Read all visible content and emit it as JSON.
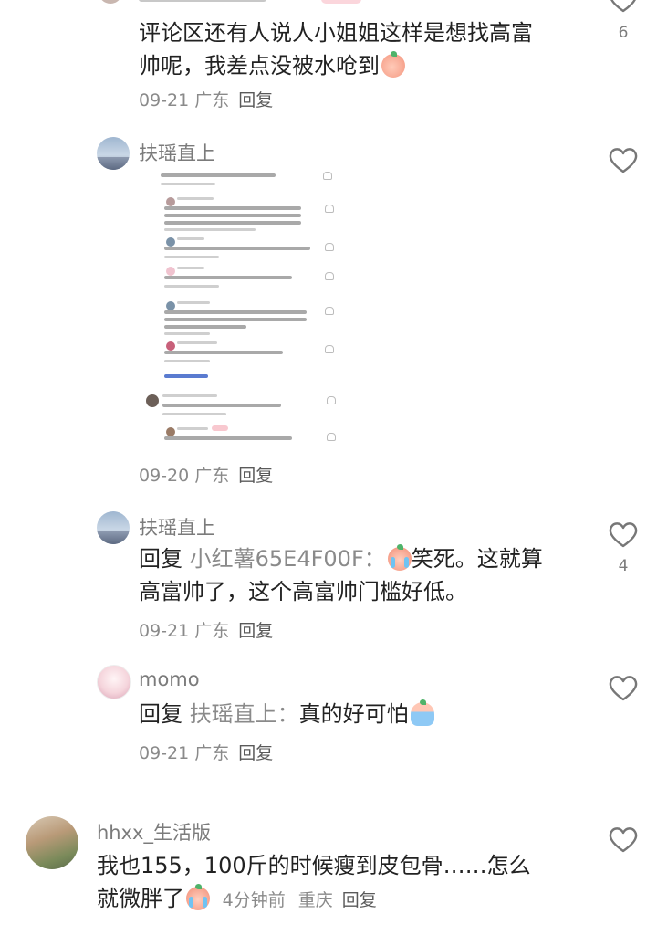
{
  "comments": [
    {
      "text_lines": [
        "评论区还有人说人小姐姐这样是想找高富",
        "帅呢，我差点没被水呛到"
      ],
      "emoji": "peach-emoji",
      "meta": {
        "date": "09-21",
        "location": "广东",
        "reply": "回复"
      },
      "like_count": "6"
    },
    {
      "name": "扶瑶直上",
      "meta": {
        "date": "09-20",
        "location": "广东",
        "reply": "回复"
      }
    },
    {
      "name": "扶瑶直上",
      "reply_prefix": "回复",
      "reply_target": "小红薯65E4F00F：",
      "text_tail": "笑死。这就算",
      "text_line2": "高富帅了，这个高富帅门槛好低。",
      "emoji": "crying-emoji",
      "meta": {
        "date": "09-21",
        "location": "广东",
        "reply": "回复"
      },
      "like_count": "4"
    },
    {
      "name": "momo",
      "reply_prefix": "回复",
      "reply_target": "扶瑶直上：",
      "text_tail": "真的好可怕",
      "emoji": "fearful-emoji",
      "meta": {
        "date": "09-21",
        "location": "广东",
        "reply": "回复"
      }
    },
    {
      "name": "hhxx_生活版",
      "text_line1": "我也155，100斤的时候瘦到皮包骨……怎么",
      "text_line2": "就微胖了",
      "emoji": "crying-emoji",
      "meta": {
        "time": "4分钟前",
        "location": "重庆",
        "reply": "回复"
      }
    }
  ],
  "colors": {
    "name": "#7b7b7b",
    "meta": "#8a8a8a",
    "text": "#222222"
  }
}
